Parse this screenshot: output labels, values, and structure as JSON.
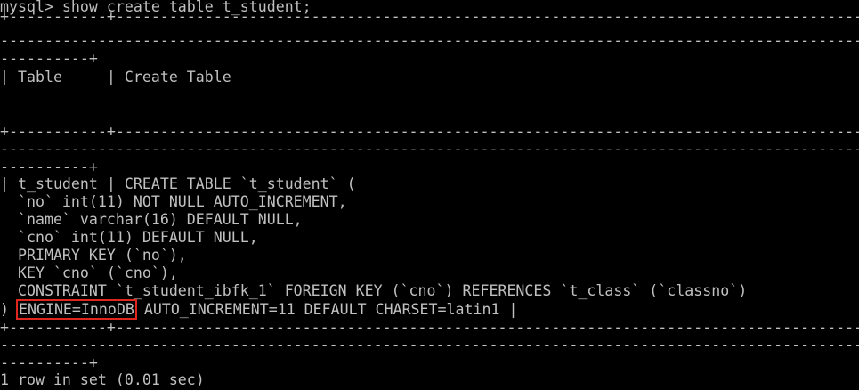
{
  "terminal": {
    "lines": [
      "mysql> show create table t_student;",
      "+-----------+---------------------------------------------------------------------------------------------------------------",
      "------------------------------------------------------------------------------------------------------------------------------------",
      "----------+",
      "| Table     | Create Table",
      "",
      "                                                                                                                              |",
      "+-----------+---------------------------------------------------------------------------------------------------------------",
      "------------------------------------------------------------------------------------------------------------------------------------",
      "----------+",
      "| t_student | CREATE TABLE `t_student` (",
      "  `no` int(11) NOT NULL AUTO_INCREMENT,",
      "  `name` varchar(16) DEFAULT NULL,",
      "  `cno` int(11) DEFAULT NULL,",
      "  PRIMARY KEY (`no`),",
      "  KEY `cno` (`cno`),",
      "  CONSTRAINT `t_student_ibfk_1` FOREIGN KEY (`cno`) REFERENCES `t_class` (`classno`)",
      "",
      "+-----------+---------------------------------------------------------------------------------------------------------------",
      "------------------------------------------------------------------------------------------------------------------------------------",
      "----------+",
      "1 row in set (0.01 sec)"
    ],
    "engine_line": {
      "prefix": ") ",
      "highlighted": "ENGINE=InnoDB",
      "suffix": " AUTO_INCREMENT=11 DEFAULT CHARSET=latin1 |"
    },
    "colors": {
      "background": "#000000",
      "text": "#c0c0c0",
      "highlight_border": "#e0271f"
    }
  }
}
